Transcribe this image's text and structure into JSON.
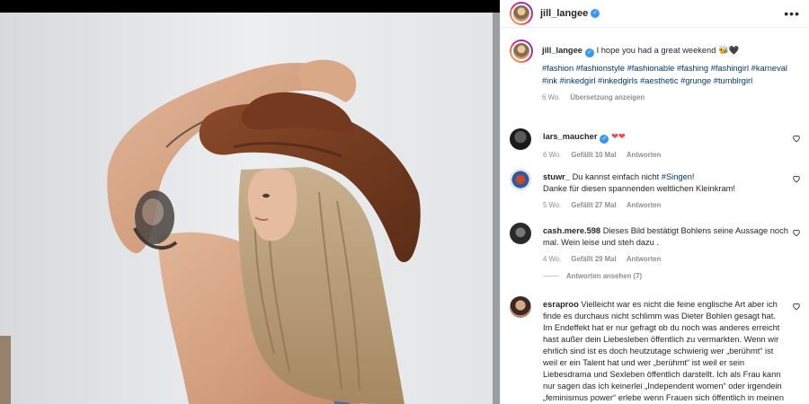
{
  "colors": {
    "accent": "#0095f6",
    "link": "#00376b",
    "verified": "#3897f0",
    "muted": "#8e8e8e",
    "heart_red": "#ed4956"
  },
  "post": {
    "username": "jill_langee",
    "caption": "I hope you had a great weekend",
    "caption_emoji": "🐝🖤",
    "hashtags": [
      "#fashion",
      "#fashionstyle",
      "#fashionable",
      "#fashing",
      "#fashingirl",
      "#karneval",
      "#ink",
      "#inkedgirl",
      "#inkedgirls",
      "#aesthetic",
      "#grunge",
      "#tumblrgirl"
    ],
    "age": "6 Wo.",
    "translate": "Übersetzung anzeigen",
    "more_icon": "more-horizontal-icon"
  },
  "comments": [
    {
      "user": "lars_maucher",
      "verified": true,
      "text": "",
      "emoji": "❤❤",
      "age": "6 Wo.",
      "likes": "Gefällt 10 Mal",
      "reply": "Antworten"
    },
    {
      "user": "stuwr_",
      "verified": false,
      "text": "Du kannst einfach nicht ",
      "link": "#Singen",
      "text_after": "!\nDanke für diesen spannenden weltlichen Kleinkram!",
      "age": "5 Wo.",
      "likes": "Gefällt 27 Mal",
      "reply": "Antworten"
    },
    {
      "user": "cash.mere.598",
      "verified": false,
      "text": "Dieses Bild bestätigt Bohlens seine Aussage noch mal. Wein leise und steh dazu .",
      "age": "4 Wo.",
      "likes": "Gefällt 29 Mal",
      "reply": "Antworten",
      "view_replies": "Antworten ansehen (7)"
    },
    {
      "user": "esraproo",
      "verified": false,
      "text": "Vielleicht war es nicht die feine englische Art aber ich finde es durchaus nicht schlimm was Dieter Bohlen gesagt hat. Im Endeffekt hat er nur gefragt ob du noch was anderes erreicht hast außer dein Liebesleben öffentlich zu vermarkten. Wenn wir ehrlich sind ist es doch heutzutage schwierig wer „berühmt“ ist weil er ein Talent hat und wer „berühmt“ ist weil er sein Liebesdrama und Sexleben öffentlich darstellt. Ich als Frau kann nur sagen das ich keinerlei „Independent women“ oder irgendein „feminismus power“ erlebe wenn Frauen sich öffentlich in meinen Augen „billig“ geben. Mein Empfinden"
    }
  ]
}
